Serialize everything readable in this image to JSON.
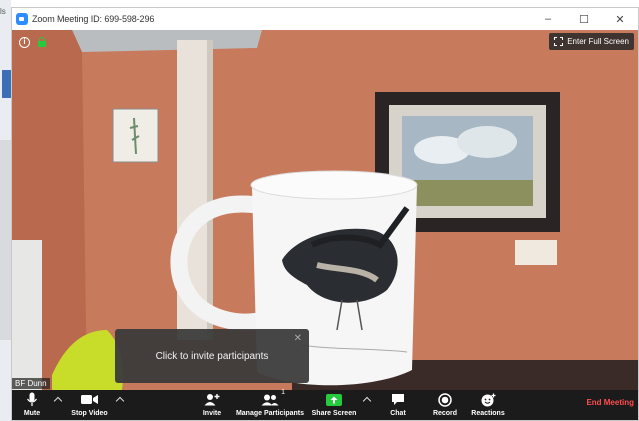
{
  "window": {
    "title": "Zoom Meeting ID: 699-598-296",
    "min_glyph": "–",
    "max_glyph": "☐",
    "close_glyph": "✕"
  },
  "video": {
    "info_glyph": "i",
    "fullscreen_label": "Enter Full Screen",
    "participant_name": "BF Dunn"
  },
  "tooltip": {
    "text": "Click to invite participants",
    "close_glyph": "✕"
  },
  "toolbar": {
    "mute_label": "Mute",
    "stop_video_label": "Stop Video",
    "invite_label": "Invite",
    "manage_participants_label": "Manage Participants",
    "participant_count": "1",
    "share_screen_label": "Share Screen",
    "chat_label": "Chat",
    "record_label": "Record",
    "reactions_label": "Reactions",
    "end_meeting_label": "End Meeting"
  },
  "colors": {
    "accent": "#2d8cff",
    "share_green": "#27c93f",
    "end_red": "#ff4d4d",
    "toolbar_bg": "#1b1b1b",
    "wall": "#c97c5e"
  },
  "icons": [
    "app-icon",
    "info-icon",
    "lock-icon",
    "fullscreen-icon",
    "microphone-icon",
    "video-camera-icon",
    "add-user-icon",
    "participants-icon",
    "share-arrow-icon",
    "chat-bubble-icon",
    "record-icon",
    "reaction-icon",
    "chevron-up-icon",
    "close-icon"
  ]
}
